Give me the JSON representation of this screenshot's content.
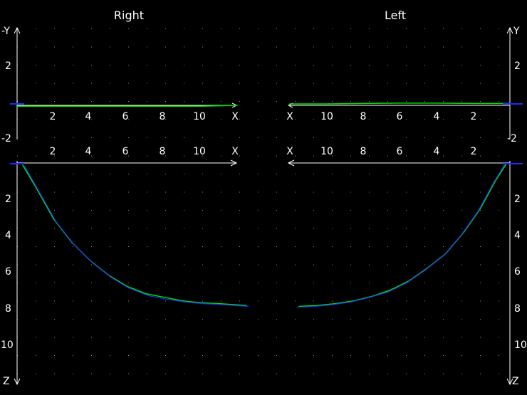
{
  "chart_data": {
    "type": "line",
    "grid": true,
    "colors": {
      "background": "#000000",
      "grid": "#8a8a8a",
      "axes": "#ffffff",
      "primary_trace": "#00e000",
      "secondary_trace": "#1e2cff"
    },
    "panels": [
      {
        "name": "top",
        "vertical_label": "Y",
        "vertical_sign_label": "-Y",
        "y_range": [
          -2,
          2
        ],
        "vertical_ticks_left": [
          "2",
          "-2"
        ],
        "vertical_ticks_right": [
          "2",
          "-2"
        ]
      },
      {
        "name": "bottom",
        "vertical_label": "Z",
        "z_range": [
          0,
          12
        ],
        "vertical_ticks_left": [
          "2",
          "4",
          "6",
          "8",
          "10"
        ],
        "vertical_ticks_right": [
          "2",
          "4",
          "6",
          "8",
          "10"
        ]
      }
    ],
    "sides": [
      {
        "title": "Right",
        "x_label": "X",
        "x_ticks": [
          "2",
          "4",
          "6",
          "8",
          "10"
        ],
        "x_range": [
          0,
          12
        ]
      },
      {
        "title": "Left",
        "x_label": "X",
        "x_ticks": [
          "10",
          "8",
          "6",
          "4",
          "2"
        ],
        "x_range": [
          0,
          12
        ]
      }
    ],
    "series": [
      {
        "side": "right",
        "panel": "top",
        "color": "primary",
        "x": [
          0,
          2,
          4,
          6,
          8,
          10,
          12
        ],
        "y": [
          -0.05,
          -0.05,
          -0.05,
          -0.05,
          -0.05,
          -0.05,
          0.0
        ]
      },
      {
        "side": "left",
        "panel": "top",
        "color": "primary",
        "x": [
          0,
          2,
          4,
          6,
          8,
          10,
          12
        ],
        "y": [
          0.1,
          0.1,
          0.12,
          0.12,
          0.1,
          0.08,
          0.08
        ]
      },
      {
        "side": "right",
        "panel": "bottom",
        "color": "primary",
        "x": [
          0.3,
          1,
          2,
          3,
          4,
          5,
          6,
          7,
          8,
          9,
          10,
          11,
          12.5
        ],
        "z": [
          0.1,
          1.3,
          3.1,
          4.4,
          5.4,
          6.2,
          6.8,
          7.2,
          7.4,
          7.6,
          7.7,
          7.75,
          7.85
        ]
      },
      {
        "side": "left",
        "panel": "bottom",
        "color": "primary",
        "x": [
          0.2,
          0.8,
          1.6,
          2.5,
          3.5,
          4.5,
          5.5,
          6.5,
          7.5,
          8.5,
          9.5,
          10.5,
          11.5
        ],
        "z": [
          0.05,
          1.0,
          2.5,
          3.8,
          5.0,
          5.8,
          6.5,
          7.0,
          7.35,
          7.6,
          7.75,
          7.85,
          7.9
        ]
      },
      {
        "side": "right",
        "panel": "bottom",
        "color": "secondary",
        "x": [
          0.4,
          1.1,
          2.1,
          3.1,
          4.1,
          5.1,
          6.1,
          7.1,
          8.1,
          9.1,
          10.1,
          11.1,
          12.6
        ],
        "z": [
          0.15,
          1.4,
          3.2,
          4.5,
          5.5,
          6.3,
          6.9,
          7.3,
          7.5,
          7.65,
          7.75,
          7.8,
          7.9
        ]
      },
      {
        "side": "left",
        "panel": "bottom",
        "color": "secondary",
        "x": [
          0.3,
          0.9,
          1.7,
          2.6,
          3.6,
          4.6,
          5.6,
          6.6,
          7.6,
          8.6,
          9.6,
          10.6,
          11.6
        ],
        "z": [
          0.1,
          1.1,
          2.6,
          3.9,
          5.1,
          5.9,
          6.6,
          7.1,
          7.4,
          7.65,
          7.8,
          7.9,
          7.95
        ]
      }
    ]
  }
}
